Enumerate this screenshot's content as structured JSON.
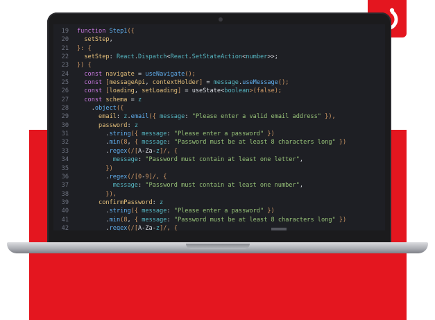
{
  "logo": {
    "icon": "refresh-ring-icon",
    "color": "#e4161f"
  },
  "editor": {
    "lines": [
      {
        "n": "19",
        "text": "function Step1({"
      },
      {
        "n": "20",
        "text": "  setStep,"
      },
      {
        "n": "21",
        "text": "}: {"
      },
      {
        "n": "22",
        "text": "  setStep: React.Dispatch<React.SetStateAction<number>>;"
      },
      {
        "n": "23",
        "text": "}) {"
      },
      {
        "n": "24",
        "text": "  const navigate = useNavigate();"
      },
      {
        "n": "25",
        "text": "  const [messageApi, contextHolder] = message.useMessage();"
      },
      {
        "n": "26",
        "text": "  const [loading, setLoading] = useState<boolean>(false);"
      },
      {
        "n": "27",
        "text": "  const schema = z"
      },
      {
        "n": "28",
        "text": "    .object({"
      },
      {
        "n": "29",
        "text": "      email: z.email({ message: \"Please enter a valid email address\" }),"
      },
      {
        "n": "30",
        "text": "      password: z"
      },
      {
        "n": "31",
        "text": "        .string({ message: \"Please enter a password\" })"
      },
      {
        "n": "32",
        "text": "        .min(8, { message: \"Password must be at least 8 characters long\" })"
      },
      {
        "n": "33",
        "text": "        .regex(/[A-Za-z]/, {"
      },
      {
        "n": "34",
        "text": "          message: \"Password must contain at least one letter\","
      },
      {
        "n": "35",
        "text": "        })"
      },
      {
        "n": "36",
        "text": "        .regex(/[0-9]/, {"
      },
      {
        "n": "37",
        "text": "          message: \"Password must contain at least one number\","
      },
      {
        "n": "38",
        "text": "        }),"
      },
      {
        "n": "39",
        "text": "      confirmPassword: z"
      },
      {
        "n": "40",
        "text": "        .string({ message: \"Please enter a password\" })"
      },
      {
        "n": "41",
        "text": "        .min(8, { message: \"Password must be at least 8 characters long\" })"
      },
      {
        "n": "42",
        "text": "        .regex(/[A-Za-z]/, {"
      }
    ]
  },
  "colors": {
    "keyword": "#c678dd",
    "function": "#61afef",
    "type": "#56b6c2",
    "string": "#98c379",
    "property": "#e5c07b",
    "variable": "#e06c75",
    "bracket": "#d19a66",
    "text": "#d7dae0"
  }
}
